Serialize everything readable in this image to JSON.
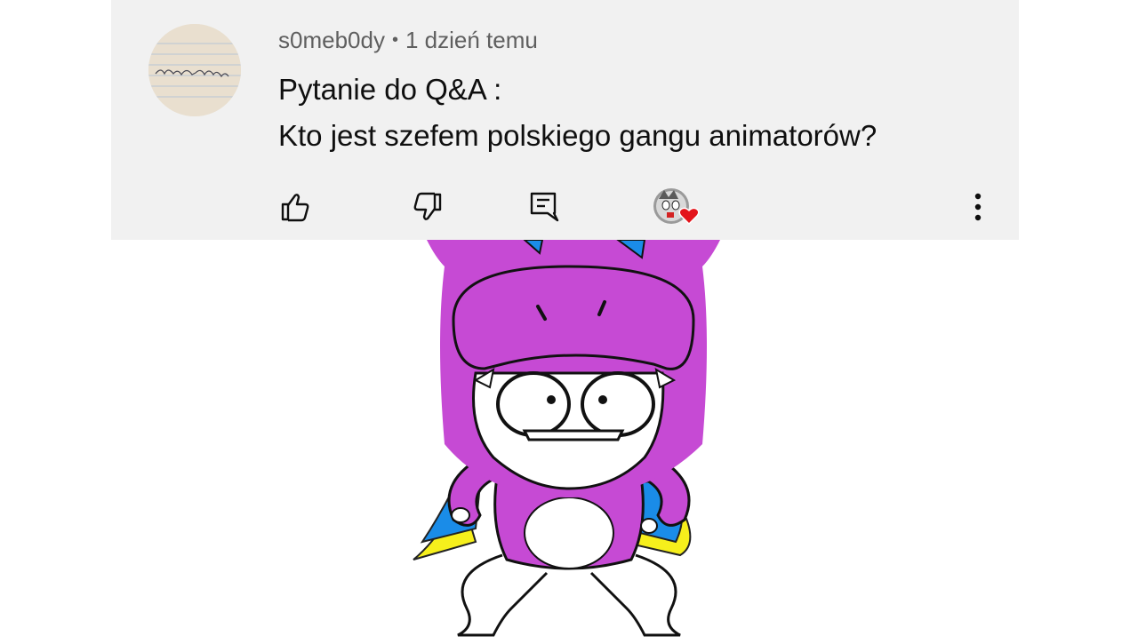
{
  "comment": {
    "author": "s0meb0dy",
    "separator": "•",
    "timestamp": "1 dzień temu",
    "lines": [
      "Pytanie do Q&A :",
      "Kto jest szefem polskiego gangu animatorów?"
    ],
    "avatar_signature": "so-neb_ody"
  },
  "actions": {
    "icons": [
      "thumbs-up-icon",
      "thumbs-down-icon",
      "reply-icon",
      "creator-heart-icon",
      "more-vert-icon"
    ]
  },
  "colors": {
    "card_background": "#f1f1f1",
    "heart": "#e3141b",
    "character_purple": "#c64ad4",
    "accent_blue": "#1a8ce8",
    "accent_yellow": "#f6ef1c"
  }
}
